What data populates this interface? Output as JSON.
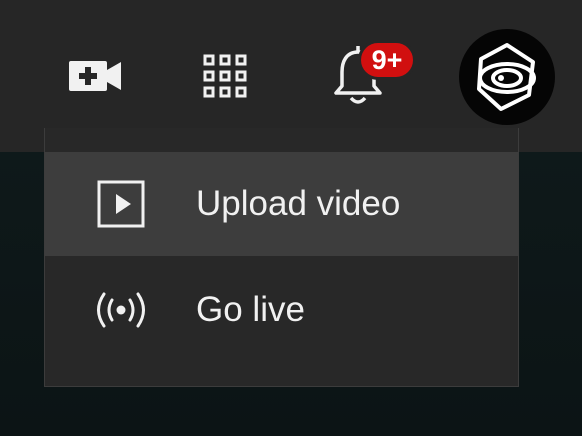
{
  "header": {
    "create_icon": "video-plus-icon",
    "apps_icon": "apps-grid-icon",
    "notifications_icon": "bell-icon",
    "notifications_badge": "9+",
    "avatar_icon": "aperture-logo-icon",
    "colors": {
      "bar": "#262626",
      "badge": "#d10f0f",
      "icon": "#f1f1f1"
    }
  },
  "create_menu": {
    "items": [
      {
        "label": "Upload video",
        "icon": "play-square-icon",
        "highlighted": true
      },
      {
        "label": "Go live",
        "icon": "broadcast-icon",
        "highlighted": false
      }
    ]
  }
}
